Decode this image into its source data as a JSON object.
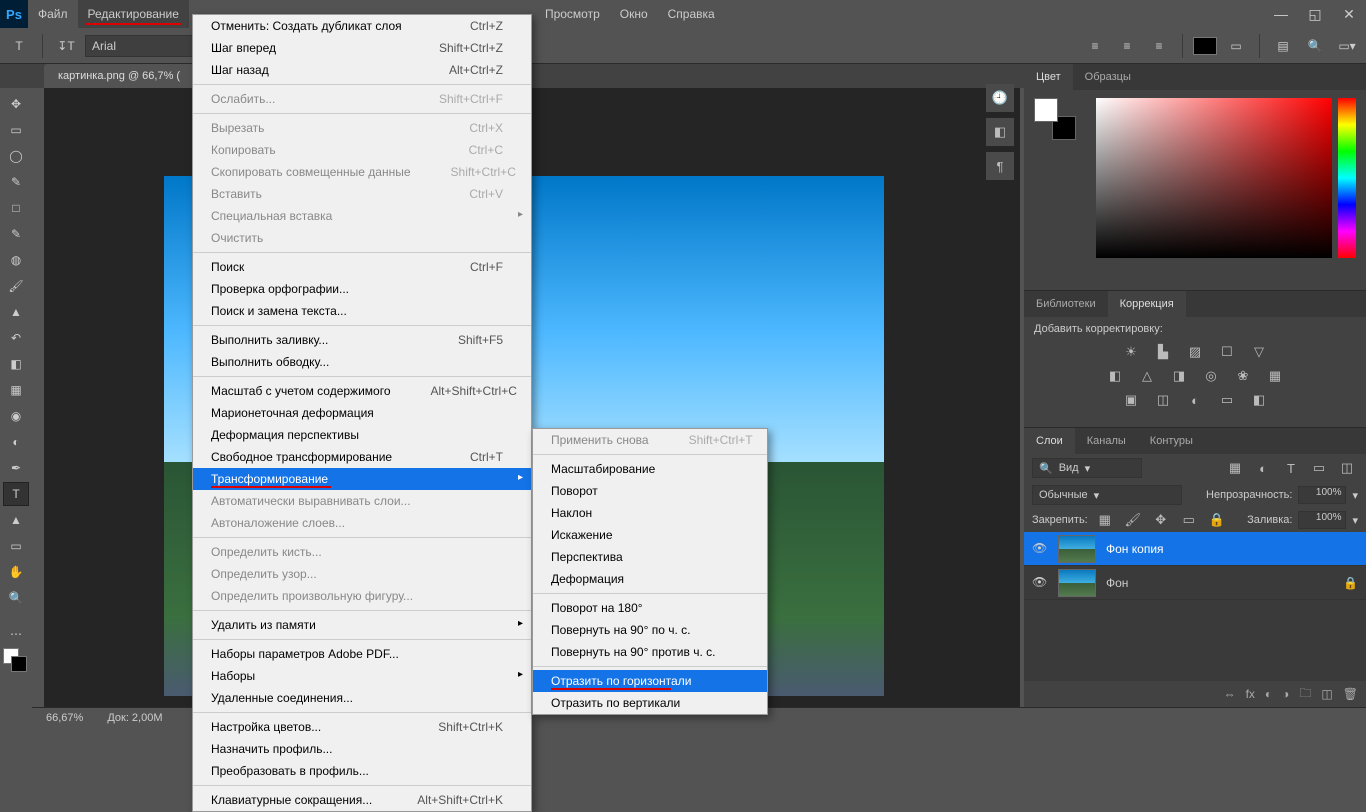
{
  "menubar": {
    "items": [
      "Файл",
      "Редактирование",
      "Просмотр",
      "Окно",
      "Справка"
    ],
    "active_index": 1
  },
  "options": {
    "font": "Arial"
  },
  "document": {
    "tab_label": "картинка.png @ 66,7% ("
  },
  "status": {
    "zoom": "66,67%",
    "doc": "Док: 2,00M"
  },
  "edit_menu": [
    {
      "label": "Отменить: Создать дубликат слоя",
      "shortcut": "Ctrl+Z"
    },
    {
      "label": "Шаг вперед",
      "shortcut": "Shift+Ctrl+Z"
    },
    {
      "label": "Шаг назад",
      "shortcut": "Alt+Ctrl+Z"
    },
    {
      "sep": true
    },
    {
      "label": "Ослабить...",
      "shortcut": "Shift+Ctrl+F",
      "disabled": true
    },
    {
      "sep": true
    },
    {
      "label": "Вырезать",
      "shortcut": "Ctrl+X",
      "disabled": true
    },
    {
      "label": "Копировать",
      "shortcut": "Ctrl+C",
      "disabled": true
    },
    {
      "label": "Скопировать совмещенные данные",
      "shortcut": "Shift+Ctrl+C",
      "disabled": true
    },
    {
      "label": "Вставить",
      "shortcut": "Ctrl+V",
      "disabled": true
    },
    {
      "label": "Специальная вставка",
      "has_sub": true,
      "disabled": true
    },
    {
      "label": "Очистить",
      "disabled": true
    },
    {
      "sep": true
    },
    {
      "label": "Поиск",
      "shortcut": "Ctrl+F"
    },
    {
      "label": "Проверка орфографии..."
    },
    {
      "label": "Поиск и замена текста..."
    },
    {
      "sep": true
    },
    {
      "label": "Выполнить заливку...",
      "shortcut": "Shift+F5"
    },
    {
      "label": "Выполнить обводку..."
    },
    {
      "sep": true
    },
    {
      "label": "Масштаб с учетом содержимого",
      "shortcut": "Alt+Shift+Ctrl+C"
    },
    {
      "label": "Марионеточная деформация"
    },
    {
      "label": "Деформация перспективы"
    },
    {
      "label": "Свободное трансформирование",
      "shortcut": "Ctrl+T"
    },
    {
      "label": "Трансформирование",
      "has_sub": true,
      "highlighted": true,
      "underline": true
    },
    {
      "label": "Автоматически выравнивать слои...",
      "disabled": true
    },
    {
      "label": "Автоналожение слоев...",
      "disabled": true
    },
    {
      "sep": true
    },
    {
      "label": "Определить кисть...",
      "disabled": true
    },
    {
      "label": "Определить узор...",
      "disabled": true
    },
    {
      "label": "Определить произвольную фигуру...",
      "disabled": true
    },
    {
      "sep": true
    },
    {
      "label": "Удалить из памяти",
      "has_sub": true
    },
    {
      "sep": true
    },
    {
      "label": "Наборы параметров Adobe PDF..."
    },
    {
      "label": "Наборы",
      "has_sub": true
    },
    {
      "label": "Удаленные соединения..."
    },
    {
      "sep": true
    },
    {
      "label": "Настройка цветов...",
      "shortcut": "Shift+Ctrl+K"
    },
    {
      "label": "Назначить профиль..."
    },
    {
      "label": "Преобразовать в профиль..."
    },
    {
      "sep": true
    },
    {
      "label": "Клавиатурные сокращения...",
      "shortcut": "Alt+Shift+Ctrl+K",
      "cut": true
    }
  ],
  "transform_submenu": [
    {
      "label": "Применить снова",
      "shortcut": "Shift+Ctrl+T",
      "disabled": true
    },
    {
      "sep": true
    },
    {
      "label": "Масштабирование"
    },
    {
      "label": "Поворот"
    },
    {
      "label": "Наклон"
    },
    {
      "label": "Искажение"
    },
    {
      "label": "Перспектива"
    },
    {
      "label": "Деформация"
    },
    {
      "sep": true
    },
    {
      "label": "Поворот на 180°"
    },
    {
      "label": "Повернуть на 90° по ч. с."
    },
    {
      "label": "Повернуть на 90° против ч. с."
    },
    {
      "sep": true
    },
    {
      "label": "Отразить по горизонтали",
      "highlighted": true,
      "underline": true
    },
    {
      "label": "Отразить по вертикали"
    }
  ],
  "panels": {
    "color_tabs": [
      "Цвет",
      "Образцы"
    ],
    "lib_tabs": [
      "Библиотеки",
      "Коррекция"
    ],
    "adjustment_title": "Добавить корректировку:",
    "layer_tabs": [
      "Слои",
      "Каналы",
      "Контуры"
    ],
    "layers_filter": "Вид",
    "blend_mode": "Обычные",
    "opacity_label": "Непрозрачность:",
    "opacity_value": "100%",
    "lock_label": "Закрепить:",
    "fill_label": "Заливка:",
    "fill_value": "100%",
    "layers": [
      {
        "name": "Фон копия",
        "selected": true
      },
      {
        "name": "Фон",
        "locked": true
      }
    ]
  }
}
